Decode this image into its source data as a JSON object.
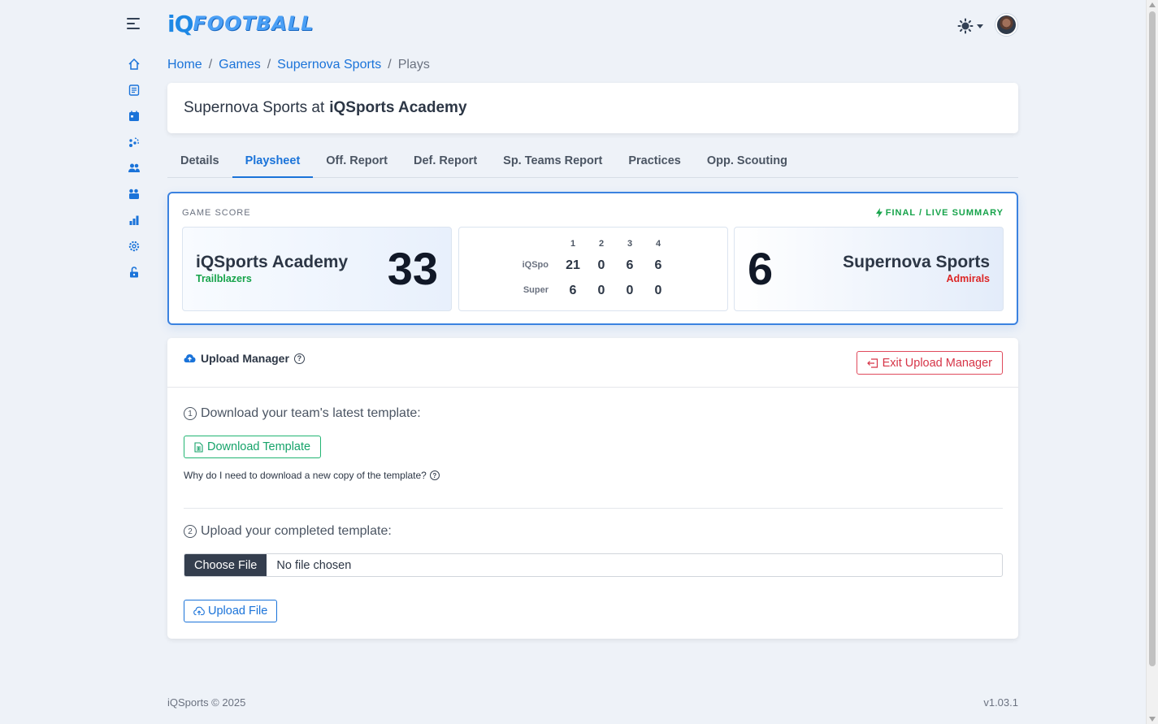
{
  "header": {
    "logo_iq": "iQ",
    "logo_text": "FOOTBALL",
    "theme_icon": "sun-icon",
    "avatar": "user-avatar"
  },
  "sidebar": {
    "items": [
      {
        "icon": "home-icon"
      },
      {
        "icon": "playbook-icon"
      },
      {
        "icon": "calendar-icon"
      },
      {
        "icon": "plays-icon"
      },
      {
        "icon": "users-icon"
      },
      {
        "icon": "teams-icon"
      },
      {
        "icon": "stats-icon"
      },
      {
        "icon": "settings-icon"
      },
      {
        "icon": "unlock-icon"
      }
    ]
  },
  "breadcrumb": {
    "home": "Home",
    "games": "Games",
    "opponent": "Supernova Sports",
    "current": "Plays",
    "sep": "/"
  },
  "title": {
    "prefix": "Supernova Sports at",
    "team": "iQSports Academy"
  },
  "tabs": [
    {
      "label": "Details"
    },
    {
      "label": "Playsheet"
    },
    {
      "label": "Off. Report"
    },
    {
      "label": "Def. Report"
    },
    {
      "label": "Sp. Teams Report"
    },
    {
      "label": "Practices"
    },
    {
      "label": "Opp. Scouting"
    }
  ],
  "score": {
    "label": "GAME SCORE",
    "status": "FINAL / LIVE SUMMARY",
    "home": {
      "name": "iQSports Academy",
      "mascot": "Trailblazers",
      "total": "33",
      "abbr": "iQSpo",
      "quarters": [
        "21",
        "0",
        "6",
        "6"
      ]
    },
    "away": {
      "name": "Supernova Sports",
      "mascot": "Admirals",
      "total": "6",
      "abbr": "Super",
      "quarters": [
        "6",
        "0",
        "0",
        "0"
      ]
    },
    "quarter_headers": [
      "1",
      "2",
      "3",
      "4"
    ]
  },
  "upload": {
    "title": "Upload Manager",
    "exit_label": "Exit Upload Manager",
    "step1_num": "1",
    "step1": "Download your team's latest template:",
    "download_label": "Download Template",
    "why": "Why do I need to download a new copy of the template?",
    "step2_num": "2",
    "step2": "Upload your completed template:",
    "choose_label": "Choose File",
    "file_status": "No file chosen",
    "upload_label": "Upload File"
  },
  "footer": {
    "copyright": "iQSports © 2025",
    "version": "v1.03.1"
  },
  "colors": {
    "accent": "#1a73d9",
    "success": "#16a34a",
    "danger": "#d63447"
  }
}
